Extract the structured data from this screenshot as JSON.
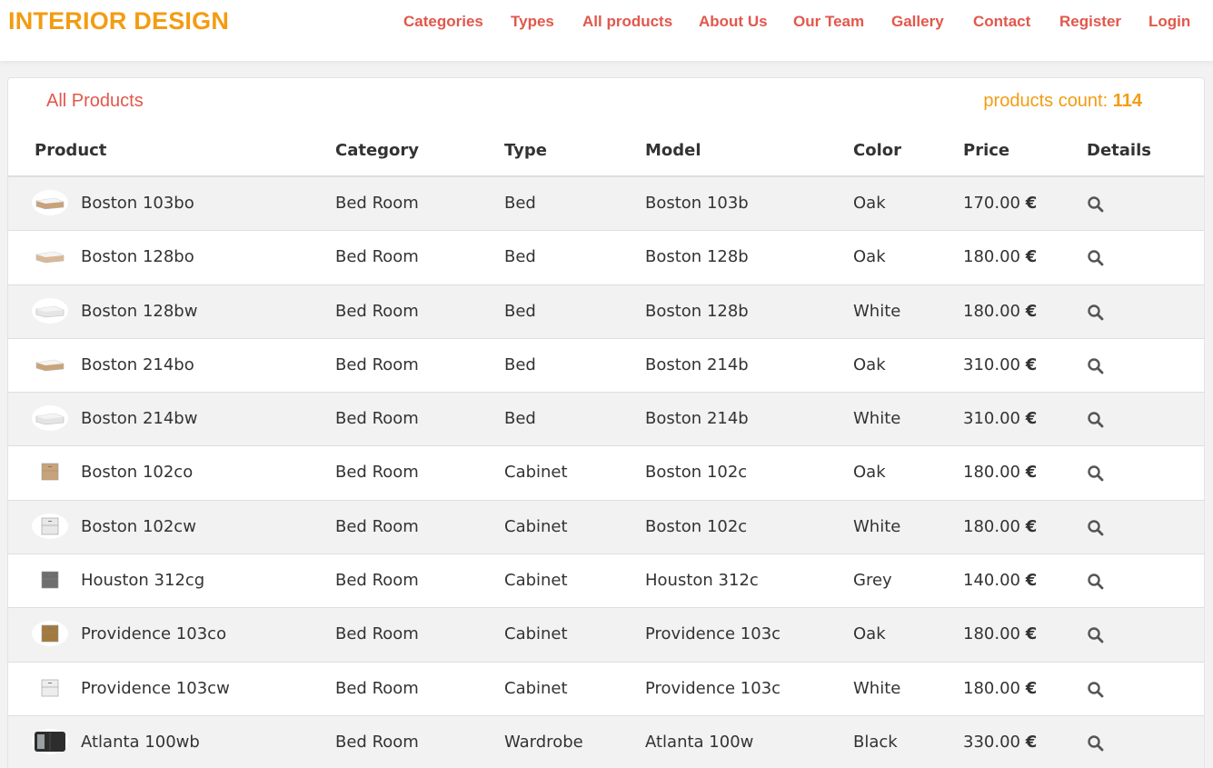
{
  "brand": "INTERIOR DESIGN",
  "nav": [
    {
      "label": "Categories"
    },
    {
      "label": "Types"
    },
    {
      "label": "All products"
    },
    {
      "label": "About Us"
    },
    {
      "label": "Our Team"
    },
    {
      "label": "Gallery"
    },
    {
      "label": "Contact"
    },
    {
      "label": "Register"
    },
    {
      "label": "Login"
    }
  ],
  "panel": {
    "title": "All Products",
    "count_label": "products count:",
    "count_value": "114"
  },
  "columns": [
    "Product",
    "Category",
    "Type",
    "Model",
    "Color",
    "Price",
    "Details"
  ],
  "currency": "€",
  "rows": [
    {
      "product": "Boston 103bo",
      "category": "Bed Room",
      "type": "Bed",
      "model": "Boston 103b",
      "color": "Oak",
      "price": "170.00",
      "thumb_icon": "bed-icon",
      "thumb_color": "#c9a27a"
    },
    {
      "product": "Boston 128bo",
      "category": "Bed Room",
      "type": "Bed",
      "model": "Boston 128b",
      "color": "Oak",
      "price": "180.00",
      "thumb_icon": "bed-icon",
      "thumb_color": "#d9b896"
    },
    {
      "product": "Boston 128bw",
      "category": "Bed Room",
      "type": "Bed",
      "model": "Boston 128b",
      "color": "White",
      "price": "180.00",
      "thumb_icon": "bed-icon",
      "thumb_color": "#e6e6e6"
    },
    {
      "product": "Boston 214bo",
      "category": "Bed Room",
      "type": "Bed",
      "model": "Boston 214b",
      "color": "Oak",
      "price": "310.00",
      "thumb_icon": "bed-icon",
      "thumb_color": "#c8a47a"
    },
    {
      "product": "Boston 214bw",
      "category": "Bed Room",
      "type": "Bed",
      "model": "Boston 214b",
      "color": "White",
      "price": "310.00",
      "thumb_icon": "bed-icon",
      "thumb_color": "#e4e4e4"
    },
    {
      "product": "Boston 102co",
      "category": "Bed Room",
      "type": "Cabinet",
      "model": "Boston 102c",
      "color": "Oak",
      "price": "180.00",
      "thumb_icon": "cabinet-icon",
      "thumb_color": "#c9a27a"
    },
    {
      "product": "Boston 102cw",
      "category": "Bed Room",
      "type": "Cabinet",
      "model": "Boston 102c",
      "color": "White",
      "price": "180.00",
      "thumb_icon": "cabinet-icon",
      "thumb_color": "#e8e8e8"
    },
    {
      "product": "Houston 312cg",
      "category": "Bed Room",
      "type": "Cabinet",
      "model": "Houston 312c",
      "color": "Grey",
      "price": "140.00",
      "thumb_icon": "cabinet-icon",
      "thumb_color": "#6e6e6e"
    },
    {
      "product": "Providence 103co",
      "category": "Bed Room",
      "type": "Cabinet",
      "model": "Providence 103c",
      "color": "Oak",
      "price": "180.00",
      "thumb_icon": "cabinet-icon",
      "thumb_color": "#a4793d"
    },
    {
      "product": "Providence 103cw",
      "category": "Bed Room",
      "type": "Cabinet",
      "model": "Providence 103c",
      "color": "White",
      "price": "180.00",
      "thumb_icon": "cabinet-icon",
      "thumb_color": "#ededed"
    },
    {
      "product": "Atlanta 100wb",
      "category": "Bed Room",
      "type": "Wardrobe",
      "model": "Atlanta 100w",
      "color": "Black",
      "price": "330.00",
      "thumb_icon": "wardrobe-icon",
      "thumb_color": "#2d2d2d"
    }
  ]
}
